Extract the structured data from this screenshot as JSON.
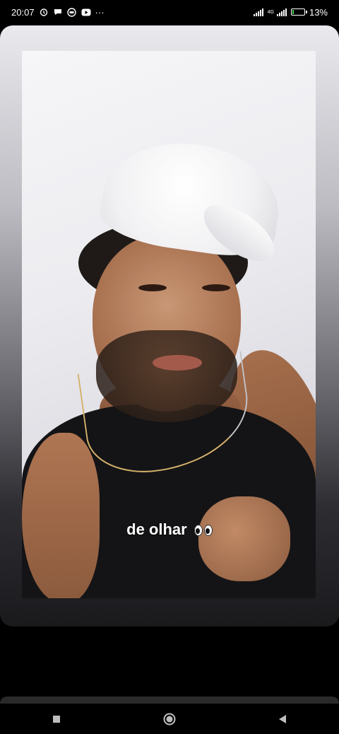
{
  "status_bar": {
    "time": "20:07",
    "more": "···",
    "network": "4G",
    "battery_percent": "13%",
    "battery_level": 0.13,
    "icons": [
      "alarm-icon",
      "chat-icon",
      "messenger-icon",
      "youtube-icon",
      "signal-icon",
      "battery-icon"
    ]
  },
  "story": {
    "caption_text": "de olhar",
    "caption_emoji": "eyes-emoji"
  },
  "nav": {
    "icons": [
      "recents-square-icon",
      "home-circle-icon",
      "back-triangle-icon"
    ]
  }
}
